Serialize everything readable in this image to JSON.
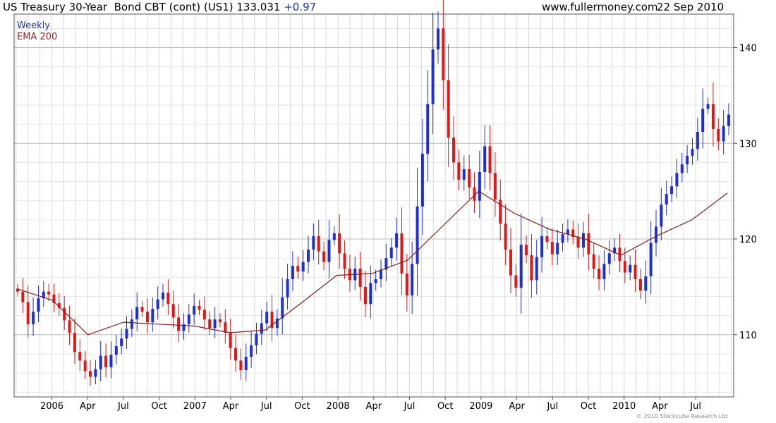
{
  "header": {
    "title": "US Treasury 30-Year  Bond CBT (cont) (US1) 133.031",
    "change": "+0.97",
    "site": "www.fullermoney.com",
    "date": "22 Sep 2010"
  },
  "legend": {
    "weekly": "Weekly",
    "ema": "EMA 200"
  },
  "copyright": "© 2010 Stockcube Research Ltd",
  "colors": {
    "up": "#1f2fd0",
    "down": "#e01818",
    "ema": "#8b1a1a",
    "grid": "#d8d8d8"
  },
  "chart_data": {
    "type": "candlestick",
    "title": "US Treasury 30-Year  Bond CBT (cont) (US1) 133.031",
    "ylim": [
      103.5,
      143.5
    ],
    "y_ticks": [
      110,
      120,
      130,
      140
    ],
    "x_ticks": [
      "2006",
      "Apr",
      "Jul",
      "Oct",
      "2007",
      "Apr",
      "Jul",
      "Oct",
      "2008",
      "Apr",
      "Jul",
      "Oct",
      "2009",
      "Apr",
      "Jul",
      "Oct",
      "2010",
      "Apr",
      "Jul"
    ],
    "grid": true,
    "series": [
      {
        "name": "Weekly",
        "kind": "weekly close path",
        "close": [
          114.5,
          113.4,
          111.1,
          112.4,
          113.8,
          114.5,
          114.2,
          113.3,
          112.8,
          111.5,
          110.2,
          108.2,
          107.3,
          106.2,
          105.6,
          106.4,
          107.8,
          106.6,
          107.9,
          108.8,
          109.6,
          110.6,
          111.6,
          112.9,
          112.4,
          111.3,
          112.7,
          113.7,
          114.4,
          113.2,
          111.8,
          110.4,
          111.1,
          112.1,
          113.0,
          112.6,
          111.6,
          110.7,
          111.6,
          111.3,
          110.2,
          108.6,
          107.3,
          106.3,
          107.7,
          108.9,
          110.1,
          111.2,
          112.4,
          110.7,
          111.7,
          113.9,
          115.8,
          117.2,
          116.6,
          117.6,
          118.9,
          120.3,
          118.7,
          117.6,
          119.9,
          120.6,
          118.5,
          116.9,
          115.7,
          116.9,
          115.0,
          113.2,
          115.4,
          115.8,
          116.8,
          118.0,
          119.1,
          120.6,
          116.4,
          114.1,
          117.4,
          123.4,
          128.9,
          134.1,
          139.8,
          142.0,
          136.6,
          130.6,
          128.0,
          126.2,
          127.3,
          125.4,
          124.0,
          127.0,
          129.7,
          126.9,
          124.1,
          121.6,
          118.9,
          116.2,
          114.9,
          119.4,
          118.3,
          115.7,
          118.1,
          120.3,
          119.7,
          118.4,
          119.6,
          120.5,
          121.0,
          120.2,
          119.1,
          120.6,
          118.4,
          116.9,
          115.8,
          117.4,
          118.5,
          119.1,
          117.7,
          116.5,
          117.3,
          115.8,
          114.6,
          116.1,
          119.6,
          121.3,
          123.6,
          124.7,
          125.5,
          126.9,
          127.8,
          128.7,
          129.4,
          131.2,
          133.6,
          134.1,
          131.5,
          130.2,
          131.8,
          133.0
        ]
      },
      {
        "name": "EMA 200",
        "kind": "line",
        "x_fraction": [
          0,
          0.05,
          0.1,
          0.15,
          0.2,
          0.25,
          0.3,
          0.35,
          0.4,
          0.45,
          0.5,
          0.55,
          0.6,
          0.65,
          0.7,
          0.75,
          0.8,
          0.85,
          0.9,
          0.95,
          1
        ],
        "y": [
          114.8,
          113.6,
          110.0,
          111.3,
          111.1,
          110.9,
          110.2,
          110.5,
          113.3,
          116.2,
          116.4,
          117.8,
          121.4,
          125.0,
          122.7,
          121.0,
          120.0,
          118.3,
          120.3,
          122.0,
          124.8
        ]
      }
    ]
  }
}
